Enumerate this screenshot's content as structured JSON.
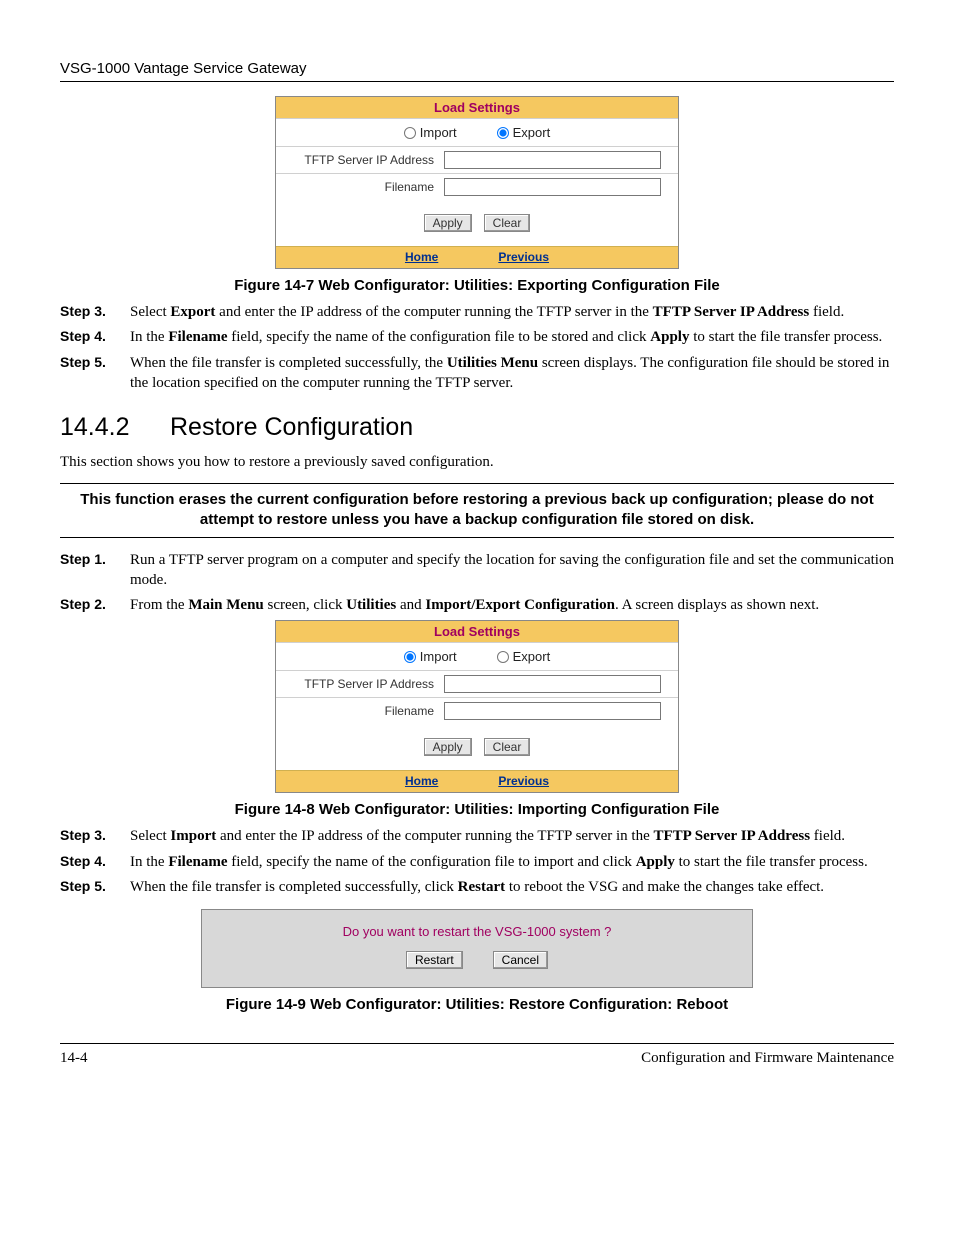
{
  "header": {
    "product": "VSG-1000 Vantage Service Gateway"
  },
  "panel1": {
    "title": "Load Settings",
    "import_label": "Import",
    "export_label": "Export",
    "selected": "export",
    "ip_label": "TFTP Server IP Address",
    "file_label": "Filename",
    "apply": "Apply",
    "clear": "Clear",
    "home": "Home",
    "previous": "Previous"
  },
  "fig7": "Figure 14-7 Web Configurator: Utilities: Exporting Configuration File",
  "steps_a": {
    "s3_label": "Step 3.",
    "s3_a": "Select ",
    "s3_b": "Export",
    "s3_c": " and enter the IP address of the computer running the TFTP server in the ",
    "s3_d": "TFTP Server IP Address",
    "s3_e": " field.",
    "s4_label": "Step 4.",
    "s4_a": "In the ",
    "s4_b": "Filename",
    "s4_c": " field, specify the name of the configuration file to be stored and click ",
    "s4_d": "Apply",
    "s4_e": " to start the file transfer process.",
    "s5_label": "Step 5.",
    "s5_a": "When the file transfer is completed successfully, the ",
    "s5_b": "Utilities Menu",
    "s5_c": " screen displays. The configuration file should be stored in the location specified on the computer running the TFTP server."
  },
  "section": {
    "num": "14.4.2",
    "title": "Restore Configuration",
    "intro": "This section shows you how to restore a previously saved configuration."
  },
  "notice": "This function erases the current configuration before restoring a previous back up configuration; please do not attempt to restore unless you have a backup configuration file stored on disk.",
  "steps_b": {
    "s1_label": "Step 1.",
    "s1": "Run a TFTP server program on a computer and specify the location for saving the configuration file and set the communication mode.",
    "s2_label": "Step 2.",
    "s2_a": "From the ",
    "s2_b": "Main Menu",
    "s2_c": " screen, click ",
    "s2_d": "Utilities",
    "s2_e": " and ",
    "s2_f": "Import/Export Configuration",
    "s2_g": ". A screen displays as shown next."
  },
  "panel2": {
    "title": "Load Settings",
    "import_label": "Import",
    "export_label": "Export",
    "selected": "import",
    "ip_label": "TFTP Server IP Address",
    "file_label": "Filename",
    "apply": "Apply",
    "clear": "Clear",
    "home": "Home",
    "previous": "Previous"
  },
  "fig8": "Figure 14-8 Web Configurator: Utilities: Importing Configuration File",
  "steps_c": {
    "s3_label": "Step 3.",
    "s3_a": "Select ",
    "s3_b": "Import",
    "s3_c": " and enter the IP address of the computer running the TFTP server in the ",
    "s3_d": "TFTP Server IP Address",
    "s3_e": " field.",
    "s4_label": "Step 4.",
    "s4_a": "In the ",
    "s4_b": "Filename",
    "s4_c": " field, specify the name of the configuration file to import and click ",
    "s4_d": "Apply",
    "s4_e": " to start the file transfer process.",
    "s5_label": "Step 5.",
    "s5_a": "When the file transfer is completed successfully, click ",
    "s5_b": "Restart",
    "s5_c": " to reboot the VSG and make the changes take effect."
  },
  "restart": {
    "question": "Do you want to restart the VSG-1000 system ?",
    "restart": "Restart",
    "cancel": "Cancel"
  },
  "fig9": "Figure 14-9 Web Configurator: Utilities: Restore Configuration: Reboot",
  "footer": {
    "page": "14-4",
    "chapter": "Configuration and Firmware Maintenance"
  }
}
